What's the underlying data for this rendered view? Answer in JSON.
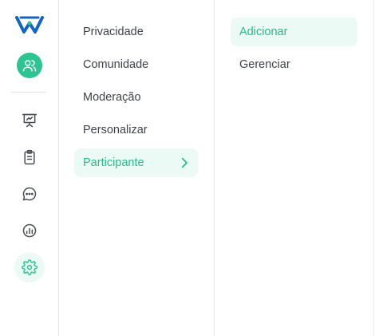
{
  "rail": {
    "logo": "brand-logo",
    "items": [
      {
        "icon": "users-icon",
        "active": false
      },
      {
        "icon": "presentation-icon",
        "active": false
      },
      {
        "icon": "clipboard-icon",
        "active": false
      },
      {
        "icon": "chat-icon",
        "active": false
      },
      {
        "icon": "chart-icon",
        "active": false
      },
      {
        "icon": "gear-icon",
        "active": true
      }
    ]
  },
  "menu": {
    "items": [
      {
        "label": "Privacidade"
      },
      {
        "label": "Comunidade"
      },
      {
        "label": "Moderação"
      },
      {
        "label": "Personalizar"
      },
      {
        "label": "Participante",
        "active": true
      }
    ]
  },
  "submenu": {
    "items": [
      {
        "label": "Adicionar",
        "active": true
      },
      {
        "label": "Gerenciar"
      }
    ]
  },
  "colors": {
    "accent": "#2fc391",
    "accent_text": "#2bb98a",
    "active_bg": "#ebfaf4",
    "logo_blue": "#1565c0"
  }
}
